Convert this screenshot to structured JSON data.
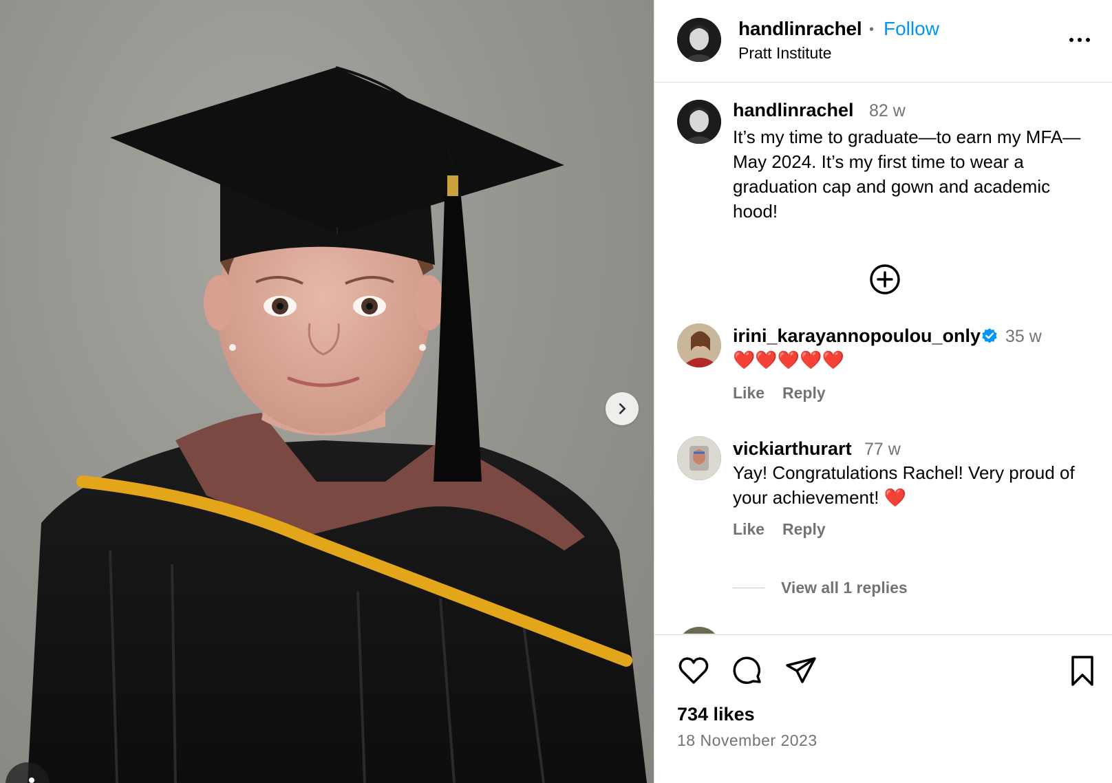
{
  "post": {
    "author": "handlinrachel",
    "separator": "•",
    "follow_label": "Follow",
    "location": "Pratt Institute",
    "more_icon": "more-horizontal-icon"
  },
  "caption": {
    "user": "handlinrachel",
    "time": "82 w",
    "text": "It’s my time to graduate—to earn my MFA—May 2024.  It’s my first time to wear a graduation cap and gown and academic hood!"
  },
  "load_more_icon": "plus-circle-icon",
  "comments": [
    {
      "user": "irini_karayannopoulou_only",
      "verified": true,
      "time": "35 w",
      "text": "❤️❤️❤️❤️❤️",
      "like_label": "Like",
      "reply_label": "Reply"
    },
    {
      "user": "vickiarthurart",
      "verified": false,
      "time": "77 w",
      "text": "Yay! Congratulations Rachel! Very proud of your achievement! ❤️",
      "like_label": "Like",
      "reply_label": "Reply",
      "view_replies_label": "View all 1 replies"
    }
  ],
  "footer": {
    "likes": "734 likes",
    "date": "18 November 2023",
    "icons": [
      "heart-icon",
      "comment-icon",
      "share-icon",
      "bookmark-icon"
    ]
  },
  "colors": {
    "link_blue": "#0095f6",
    "secondary_text": "#737373",
    "verified_blue": "#0095f6",
    "heart_red": "#ff3040"
  }
}
